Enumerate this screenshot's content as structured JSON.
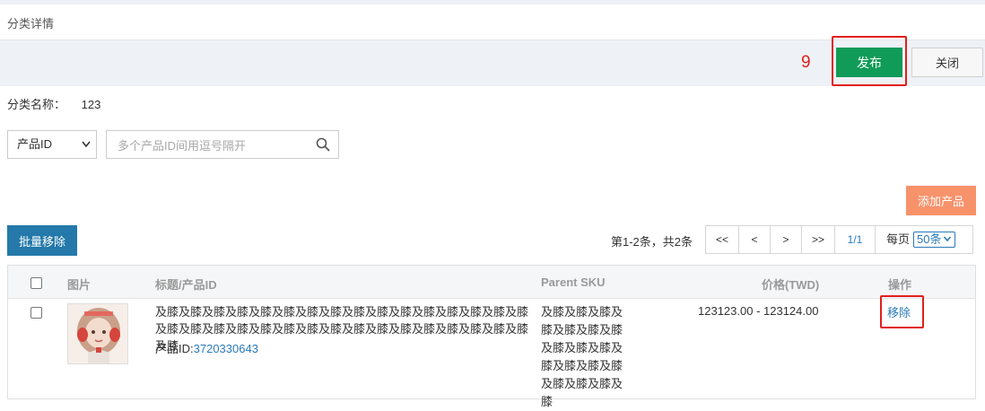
{
  "page": {
    "title": "分类详情"
  },
  "toolbar": {
    "step_number": "9",
    "publish_label": "发布",
    "close_label": "关闭"
  },
  "category": {
    "label": "分类名称：",
    "value": "123"
  },
  "search": {
    "type_value": "产品ID",
    "placeholder": "多个产品ID间用逗号隔开"
  },
  "actions": {
    "add_product_label": "添加产品",
    "batch_remove_label": "批量移除"
  },
  "pagination": {
    "summary": "第1-2条，共2条",
    "first": "<<",
    "prev": "<",
    "next": ">",
    "last": ">>",
    "current": "1/1",
    "per_page_label": "每页",
    "per_page_value": "50条"
  },
  "table": {
    "headers": {
      "image": "图片",
      "title": "标题/产品ID",
      "sku": "Parent SKU",
      "price": "价格(TWD)",
      "action": "操作"
    },
    "rows": [
      {
        "title": "及膝及膝及膝及膝及膝及膝及膝及膝及膝及膝及膝及膝及膝及膝及膝及膝及膝及膝及膝及膝及膝及膝及膝及膝及膝及膝及膝及膝及膝及膝及膝及膝及膝",
        "product_id_label": "产品ID:",
        "product_id": "3720330643",
        "parent_sku": "及膝及膝及膝及膝及膝及膝及膝及膝及膝及膝及膝及膝及膝及膝及膝及膝及膝及膝",
        "price": "123123.00 - 123124.00",
        "action_label": "移除"
      }
    ]
  },
  "colors": {
    "publish": "#119b58",
    "add_product": "#f7926b",
    "batch_remove": "#2479aa",
    "highlight": "#e0201b",
    "link": "#2a7ab8"
  }
}
